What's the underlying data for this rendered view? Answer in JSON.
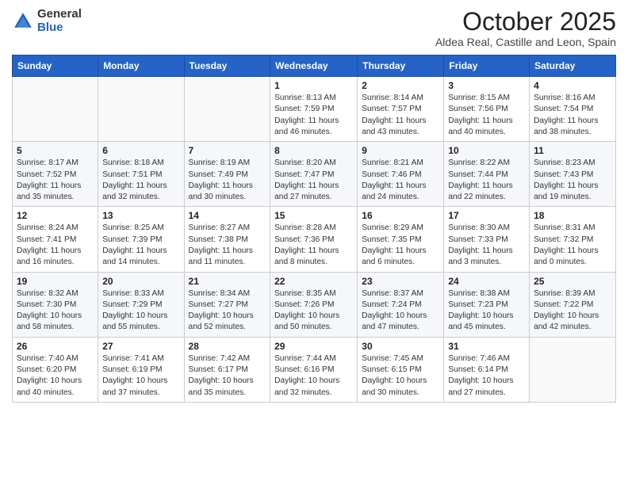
{
  "logo": {
    "general": "General",
    "blue": "Blue"
  },
  "header": {
    "month": "October 2025",
    "location": "Aldea Real, Castille and Leon, Spain"
  },
  "weekdays": [
    "Sunday",
    "Monday",
    "Tuesday",
    "Wednesday",
    "Thursday",
    "Friday",
    "Saturday"
  ],
  "weeks": [
    [
      {
        "day": "",
        "info": ""
      },
      {
        "day": "",
        "info": ""
      },
      {
        "day": "",
        "info": ""
      },
      {
        "day": "1",
        "info": "Sunrise: 8:13 AM\nSunset: 7:59 PM\nDaylight: 11 hours and 46 minutes."
      },
      {
        "day": "2",
        "info": "Sunrise: 8:14 AM\nSunset: 7:57 PM\nDaylight: 11 hours and 43 minutes."
      },
      {
        "day": "3",
        "info": "Sunrise: 8:15 AM\nSunset: 7:56 PM\nDaylight: 11 hours and 40 minutes."
      },
      {
        "day": "4",
        "info": "Sunrise: 8:16 AM\nSunset: 7:54 PM\nDaylight: 11 hours and 38 minutes."
      }
    ],
    [
      {
        "day": "5",
        "info": "Sunrise: 8:17 AM\nSunset: 7:52 PM\nDaylight: 11 hours and 35 minutes."
      },
      {
        "day": "6",
        "info": "Sunrise: 8:18 AM\nSunset: 7:51 PM\nDaylight: 11 hours and 32 minutes."
      },
      {
        "day": "7",
        "info": "Sunrise: 8:19 AM\nSunset: 7:49 PM\nDaylight: 11 hours and 30 minutes."
      },
      {
        "day": "8",
        "info": "Sunrise: 8:20 AM\nSunset: 7:47 PM\nDaylight: 11 hours and 27 minutes."
      },
      {
        "day": "9",
        "info": "Sunrise: 8:21 AM\nSunset: 7:46 PM\nDaylight: 11 hours and 24 minutes."
      },
      {
        "day": "10",
        "info": "Sunrise: 8:22 AM\nSunset: 7:44 PM\nDaylight: 11 hours and 22 minutes."
      },
      {
        "day": "11",
        "info": "Sunrise: 8:23 AM\nSunset: 7:43 PM\nDaylight: 11 hours and 19 minutes."
      }
    ],
    [
      {
        "day": "12",
        "info": "Sunrise: 8:24 AM\nSunset: 7:41 PM\nDaylight: 11 hours and 16 minutes."
      },
      {
        "day": "13",
        "info": "Sunrise: 8:25 AM\nSunset: 7:39 PM\nDaylight: 11 hours and 14 minutes."
      },
      {
        "day": "14",
        "info": "Sunrise: 8:27 AM\nSunset: 7:38 PM\nDaylight: 11 hours and 11 minutes."
      },
      {
        "day": "15",
        "info": "Sunrise: 8:28 AM\nSunset: 7:36 PM\nDaylight: 11 hours and 8 minutes."
      },
      {
        "day": "16",
        "info": "Sunrise: 8:29 AM\nSunset: 7:35 PM\nDaylight: 11 hours and 6 minutes."
      },
      {
        "day": "17",
        "info": "Sunrise: 8:30 AM\nSunset: 7:33 PM\nDaylight: 11 hours and 3 minutes."
      },
      {
        "day": "18",
        "info": "Sunrise: 8:31 AM\nSunset: 7:32 PM\nDaylight: 11 hours and 0 minutes."
      }
    ],
    [
      {
        "day": "19",
        "info": "Sunrise: 8:32 AM\nSunset: 7:30 PM\nDaylight: 10 hours and 58 minutes."
      },
      {
        "day": "20",
        "info": "Sunrise: 8:33 AM\nSunset: 7:29 PM\nDaylight: 10 hours and 55 minutes."
      },
      {
        "day": "21",
        "info": "Sunrise: 8:34 AM\nSunset: 7:27 PM\nDaylight: 10 hours and 52 minutes."
      },
      {
        "day": "22",
        "info": "Sunrise: 8:35 AM\nSunset: 7:26 PM\nDaylight: 10 hours and 50 minutes."
      },
      {
        "day": "23",
        "info": "Sunrise: 8:37 AM\nSunset: 7:24 PM\nDaylight: 10 hours and 47 minutes."
      },
      {
        "day": "24",
        "info": "Sunrise: 8:38 AM\nSunset: 7:23 PM\nDaylight: 10 hours and 45 minutes."
      },
      {
        "day": "25",
        "info": "Sunrise: 8:39 AM\nSunset: 7:22 PM\nDaylight: 10 hours and 42 minutes."
      }
    ],
    [
      {
        "day": "26",
        "info": "Sunrise: 7:40 AM\nSunset: 6:20 PM\nDaylight: 10 hours and 40 minutes."
      },
      {
        "day": "27",
        "info": "Sunrise: 7:41 AM\nSunset: 6:19 PM\nDaylight: 10 hours and 37 minutes."
      },
      {
        "day": "28",
        "info": "Sunrise: 7:42 AM\nSunset: 6:17 PM\nDaylight: 10 hours and 35 minutes."
      },
      {
        "day": "29",
        "info": "Sunrise: 7:44 AM\nSunset: 6:16 PM\nDaylight: 10 hours and 32 minutes."
      },
      {
        "day": "30",
        "info": "Sunrise: 7:45 AM\nSunset: 6:15 PM\nDaylight: 10 hours and 30 minutes."
      },
      {
        "day": "31",
        "info": "Sunrise: 7:46 AM\nSunset: 6:14 PM\nDaylight: 10 hours and 27 minutes."
      },
      {
        "day": "",
        "info": ""
      }
    ]
  ]
}
